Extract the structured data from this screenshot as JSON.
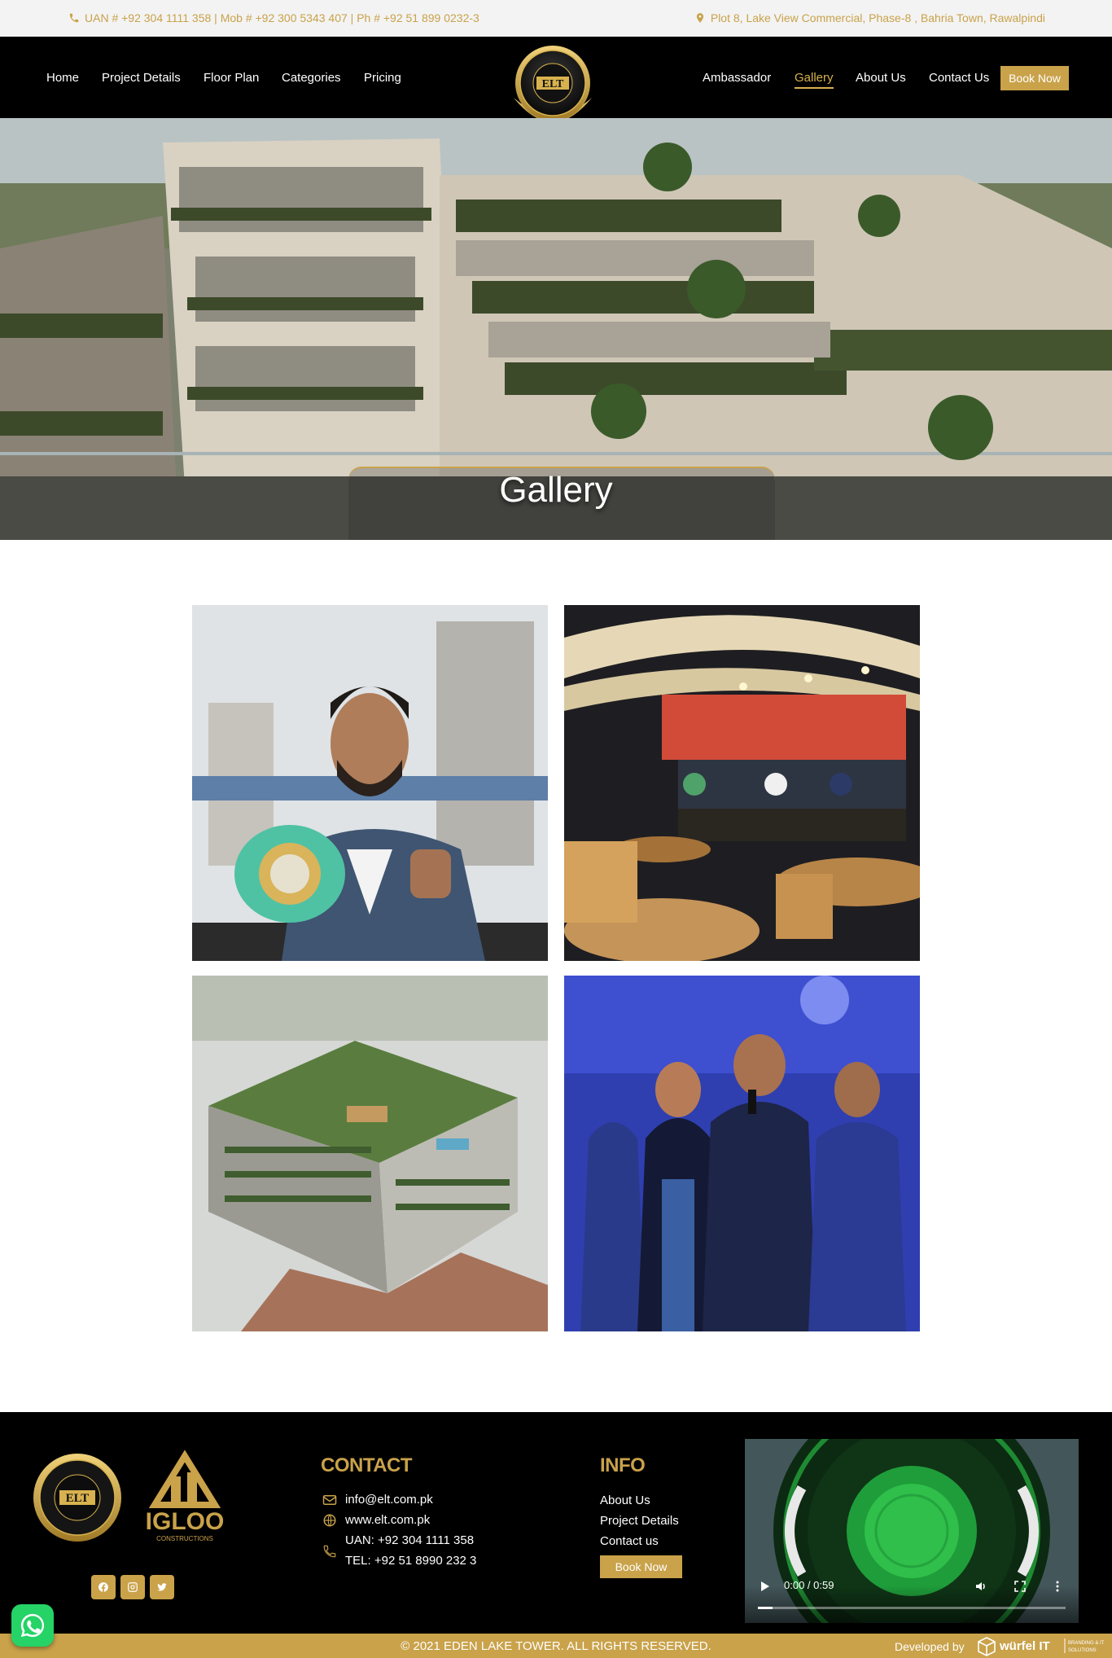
{
  "topbar": {
    "phones": "UAN # +92 304 1111 358 | Mob # +92 300 5343 407 | Ph # +92 51 899 0232-3",
    "address": "Plot 8, Lake View Commercial, Phase-8 , Bahria Town, Rawalpindi"
  },
  "nav": {
    "left": [
      "Home",
      "Project Details",
      "Floor Plan",
      "Categories",
      "Pricing"
    ],
    "right": [
      "Ambassador",
      "Gallery",
      "About Us",
      "Contact Us"
    ],
    "active": "Gallery",
    "book_now": "Book Now"
  },
  "hero": {
    "title": "Gallery"
  },
  "gallery": {
    "images": [
      "boxer-with-belt",
      "restaurant-interior",
      "building-aerial-render",
      "event-stage"
    ]
  },
  "footer": {
    "contact_heading": "CONTACT",
    "email": "info@elt.com.pk",
    "website": "www.elt.com.pk",
    "uan": "UAN: +92 304 1111 358",
    "tel": "TEL:   +92 51 8990 232 3",
    "info_heading": "INFO",
    "info_links": [
      "About Us",
      "Project Details",
      "Contact us"
    ],
    "book_now": "Book Now",
    "video_time": "0:00 / 0:59"
  },
  "bottom": {
    "copyright": "© 2021 EDEN LAKE TOWER. ALL RIGHTS RESERVED.",
    "developed_by": "Developed by"
  },
  "colors": {
    "gold": "#c9a24a",
    "black": "#000000"
  }
}
